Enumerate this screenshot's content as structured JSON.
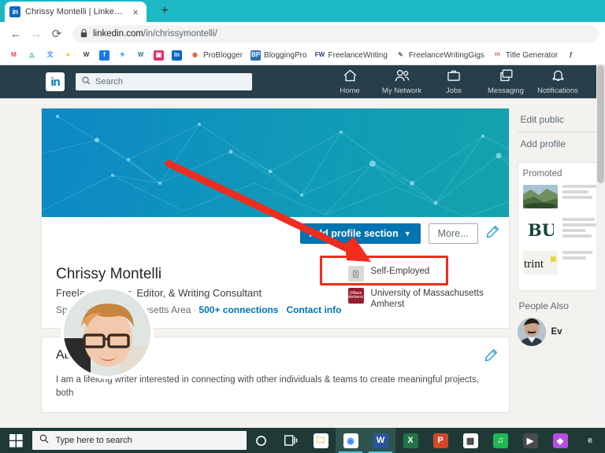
{
  "browser": {
    "tab": {
      "title": "Chrissy Montelli | LinkedIn",
      "favicon": "linkedin-icon",
      "favicon_text": "in",
      "close": "×"
    },
    "new_tab": "+",
    "nav": {
      "back": "←",
      "forward": "→",
      "reload": "⟳"
    },
    "address": {
      "lock": "🔒",
      "url_bold": "linkedin.com",
      "url_rest": "/in/chrissymontelli/"
    },
    "bookmarks": [
      {
        "label": "",
        "icon": "gmail-icon",
        "glyph": "M",
        "bg": "#ffffff",
        "fg": "#ea4335"
      },
      {
        "label": "",
        "icon": "google-drive-icon",
        "glyph": "△",
        "bg": "#ffffff",
        "fg": "#0da960"
      },
      {
        "label": "",
        "icon": "google-translate-icon",
        "glyph": "文",
        "bg": "#ffffff",
        "fg": "#4285f4"
      },
      {
        "label": "",
        "icon": "google-maps-icon",
        "glyph": "●",
        "bg": "#ffffff",
        "fg": "#fbbc04"
      },
      {
        "label": "",
        "icon": "wikipedia-icon",
        "glyph": "W",
        "bg": "#ffffff",
        "fg": "#3c3c3c"
      },
      {
        "label": "",
        "icon": "facebook-icon",
        "glyph": "f",
        "bg": "#1877f2",
        "fg": "#ffffff"
      },
      {
        "label": "",
        "icon": "twitter-icon",
        "glyph": "✈",
        "bg": "#ffffff",
        "fg": "#1da1f2"
      },
      {
        "label": "",
        "icon": "wordpress-icon",
        "glyph": "W",
        "bg": "#ffffff",
        "fg": "#21759b"
      },
      {
        "label": "",
        "icon": "instagram-icon",
        "glyph": "▣",
        "bg": "#e1306c",
        "fg": "#ffffff"
      },
      {
        "label": "",
        "icon": "linkedin-icon",
        "glyph": "in",
        "bg": "#0a66c2",
        "fg": "#ffffff"
      },
      {
        "label": "ProBlogger",
        "icon": "problogger-icon",
        "glyph": "◉",
        "bg": "#ffffff",
        "fg": "#e8622c"
      },
      {
        "label": "BloggingPro",
        "icon": "bloggingpro-icon",
        "glyph": "BP",
        "bg": "#2f6fb4",
        "fg": "#ffffff"
      },
      {
        "label": "FreelanceWriting",
        "icon": "freelancewriting-icon",
        "glyph": "FW",
        "bg": "#ffffff",
        "fg": "#2b3a8f"
      },
      {
        "label": "FreelanceWritingGigs",
        "icon": "freelancewritinggigs-icon",
        "glyph": "✎",
        "bg": "#ffffff",
        "fg": "#5d6a72"
      },
      {
        "label": "Title Generator",
        "icon": "title-generator-icon",
        "glyph": "TIT",
        "bg": "#ffffff",
        "fg": "#c0392b"
      },
      {
        "label": "",
        "icon": "fonts-icon",
        "glyph": "ƒ",
        "bg": "#ffffff",
        "fg": "#3c3c3c"
      }
    ]
  },
  "linkedin": {
    "logo_text": "in",
    "search": {
      "placeholder": "Search",
      "icon": "search-icon"
    },
    "nav_items": [
      {
        "label": "Home",
        "icon": "home-icon"
      },
      {
        "label": "My Network",
        "icon": "people-icon"
      },
      {
        "label": "Jobs",
        "icon": "briefcase-icon"
      },
      {
        "label": "Messaging",
        "icon": "message-icon"
      },
      {
        "label": "Notifications",
        "icon": "bell-icon"
      }
    ],
    "profile": {
      "name": "Chrissy Montelli",
      "headline": "Freelance Writer, Editor, & Writing Consultant",
      "location": "Springfield, Massachusetts Area",
      "connections": "500+ connections",
      "contact_info": "Contact info",
      "separator": "·",
      "add_section_button": "Add profile section",
      "add_section_caret": "▼",
      "more_button": "More...",
      "edit_icon": "pencil-icon",
      "affiliations": [
        {
          "name": "Self-Employed",
          "logo": "self-employed-logo",
          "logo_text": "",
          "bg": "#d8d8d8",
          "fg": "#8a8a8a"
        },
        {
          "name": "University of Massachusetts Amherst",
          "logo": "umass-amherst-logo",
          "logo_text": "UMass Amherst",
          "bg": "#971b2f",
          "fg": "#ffffff"
        }
      ]
    },
    "about": {
      "title": "About",
      "edit_icon": "pencil-icon",
      "text": "I am a lifelong writer interested in connecting with other individuals & teams to create meaningful projects, both"
    },
    "sidebar": {
      "edit_public_profile": "Edit public",
      "add_profile_section": "Add profile",
      "promoted_title": "Promoted",
      "promoted": [
        {
          "thumb": "landscape-thumb",
          "kind": "photo"
        },
        {
          "thumb": "baylor-university-logo",
          "kind": "logo",
          "glyph": "BU",
          "fg": "#154734"
        },
        {
          "thumb": "trint-logo",
          "kind": "wordmark",
          "glyph": "trint",
          "fg": "#1a1a1a"
        }
      ],
      "people_also_viewed_title": "People Also",
      "people": [
        {
          "name": "Ev",
          "avatar": "person-avatar"
        }
      ]
    }
  },
  "annotation": {
    "arrow": {
      "color": "#ee2d1e",
      "points_to": "add-profile-section-button"
    },
    "highlight_box": {
      "color": "#ee2d1e",
      "target": "add-profile-section-button"
    }
  },
  "taskbar": {
    "start": "windows-logo-icon",
    "search": {
      "placeholder": "Type here to search",
      "icon": "search-icon"
    },
    "cortana": "cortana-icon",
    "task_view": "task-view-icon",
    "apps": [
      {
        "name": "file-explorer",
        "glyph": "🗀",
        "bg": "#ffffff",
        "fg": "#e8b33b",
        "active": false
      },
      {
        "name": "google-chrome",
        "glyph": "◉",
        "bg": "#ffffff",
        "fg": "#4285f4",
        "active": true
      },
      {
        "name": "microsoft-word",
        "glyph": "W",
        "bg": "#2b579a",
        "fg": "#ffffff",
        "active": true
      },
      {
        "name": "microsoft-excel",
        "glyph": "X",
        "bg": "#217346",
        "fg": "#ffffff",
        "active": false
      },
      {
        "name": "microsoft-powerpoint",
        "glyph": "P",
        "bg": "#d24726",
        "fg": "#ffffff",
        "active": false
      },
      {
        "name": "calculator",
        "glyph": "▦",
        "bg": "#ffffff",
        "fg": "#3c3c3c",
        "active": false
      },
      {
        "name": "spotify",
        "glyph": "♫",
        "bg": "#1db954",
        "fg": "#ffffff",
        "active": false
      },
      {
        "name": "zoom",
        "glyph": "▶",
        "bg": "#4a4a4a",
        "fg": "#ffffff",
        "active": false
      },
      {
        "name": "app-purple",
        "glyph": "◆",
        "bg": "#b44de0",
        "fg": "#ffffff",
        "active": false
      },
      {
        "name": "app-edge",
        "glyph": "e",
        "bg": "#1f3a36",
        "fg": "#bfcfcb",
        "active": false
      }
    ]
  }
}
